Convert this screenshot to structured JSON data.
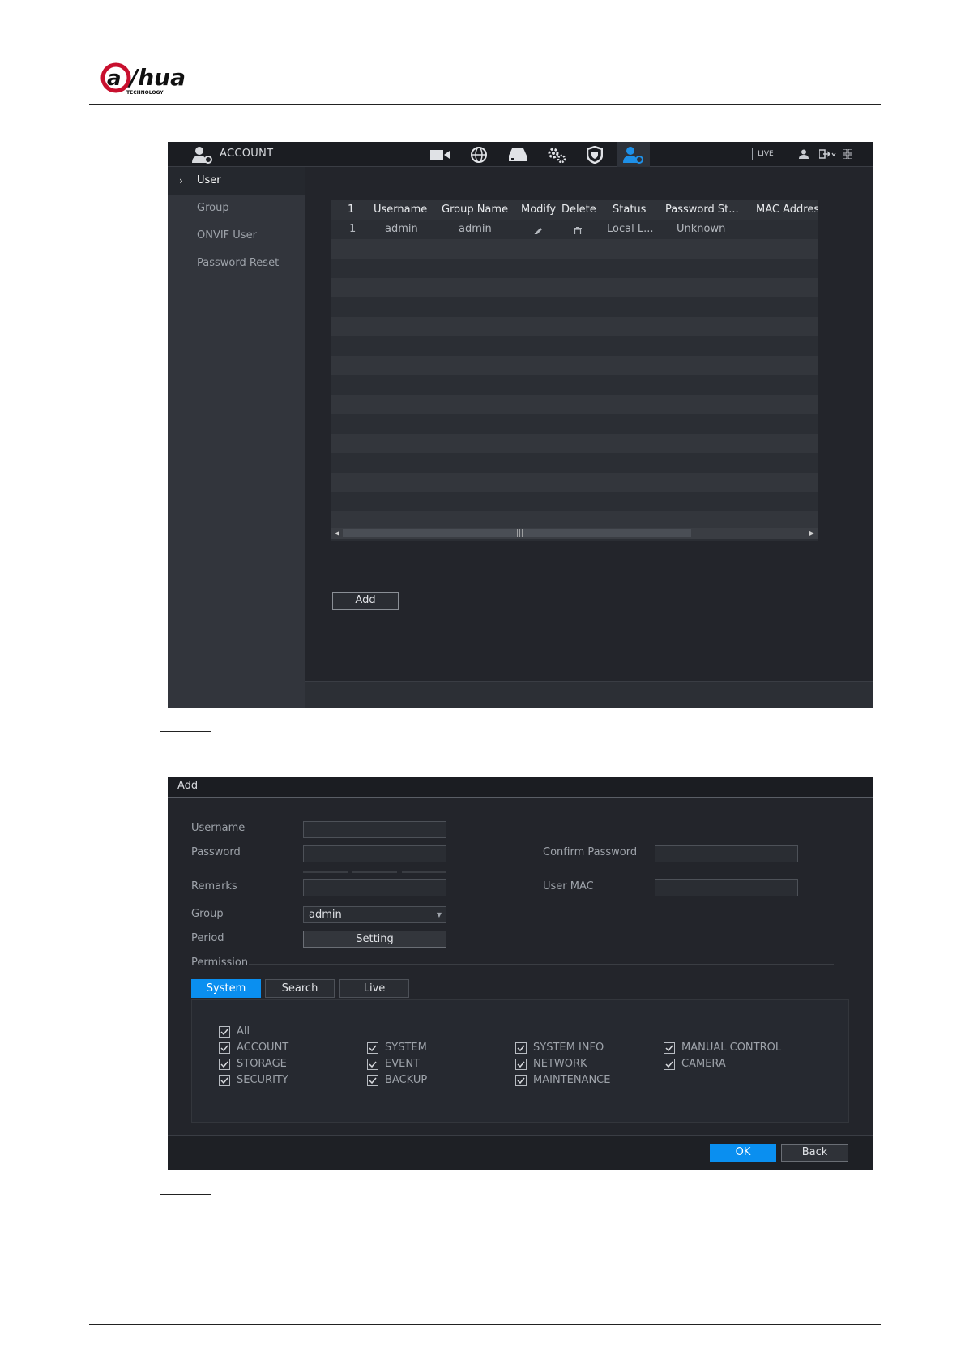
{
  "brand": {
    "logo_text": "alhua",
    "logo_sub": "TECHNOLOGY"
  },
  "colors": {
    "accent": "#0a8ff0",
    "panel": "#23252b",
    "sidebar": "#32353c"
  },
  "account_screen": {
    "header": {
      "title": "ACCOUNT",
      "live_label": "LIVE"
    },
    "nav_icons": [
      "camera-icon",
      "network-globe-icon",
      "storage-icon",
      "system-gears-icon",
      "security-shield-icon",
      "account-icon"
    ],
    "sidebar": {
      "items": [
        {
          "label": "User",
          "active": true
        },
        {
          "label": "Group"
        },
        {
          "label": "ONVIF User"
        },
        {
          "label": "Password Reset"
        }
      ]
    },
    "table": {
      "columns": [
        "1",
        "Username",
        "Group Name",
        "Modify",
        "Delete",
        "Status",
        "Password St...",
        "MAC Addres"
      ],
      "rows": [
        {
          "index": "1",
          "username": "admin",
          "group": "admin",
          "status": "Local L...",
          "password_strength": "Unknown"
        }
      ]
    },
    "add_label": "Add"
  },
  "add_dialog": {
    "title": "Add",
    "labels": {
      "username": "Username",
      "password": "Password",
      "confirm_password": "Confirm Password",
      "remarks": "Remarks",
      "user_mac": "User MAC",
      "group": "Group",
      "period": "Period",
      "permission": "Permission"
    },
    "group_value": "admin",
    "period_button": "Setting",
    "tabs": [
      "System",
      "Search",
      "Live"
    ],
    "active_tab": "System",
    "permissions": {
      "all": "All",
      "items": [
        "ACCOUNT",
        "SYSTEM",
        "SYSTEM INFO",
        "MANUAL CONTROL",
        "STORAGE",
        "EVENT",
        "NETWORK",
        "CAMERA",
        "SECURITY",
        "BACKUP",
        "MAINTENANCE"
      ]
    },
    "ok_label": "OK",
    "back_label": "Back"
  }
}
